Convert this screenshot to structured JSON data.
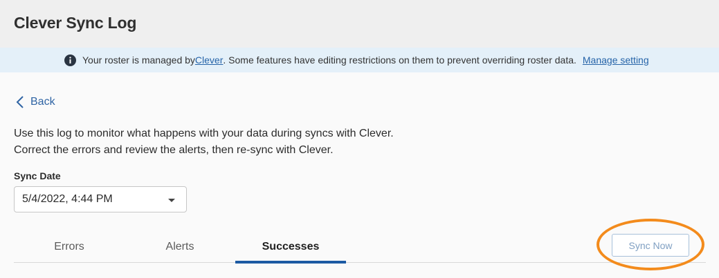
{
  "header": {
    "title": "Clever Sync Log"
  },
  "banner": {
    "icon": "info-icon",
    "text_before": "Your roster is managed by ",
    "clever_link": "Clever",
    "text_after": ". Some features have editing restrictions on them to prevent overriding roster data.",
    "manage_link": "Manage setting"
  },
  "nav": {
    "back_label": "Back",
    "back_icon": "chevron-left-icon"
  },
  "description": {
    "line1": "Use this log to monitor what happens with your data during syncs with Clever.",
    "line2": "Correct the errors and review the alerts, then re-sync with Clever."
  },
  "sync_date": {
    "label": "Sync Date",
    "selected": "5/4/2022, 4:44 PM"
  },
  "tabs": [
    {
      "label": "Errors",
      "active": false
    },
    {
      "label": "Alerts",
      "active": false
    },
    {
      "label": "Successes",
      "active": true
    }
  ],
  "actions": {
    "sync_now_label": "Sync Now"
  },
  "colors": {
    "accent": "#1c5aa3",
    "link": "#2563a8",
    "banner_bg": "#e4f0f9",
    "highlight": "#f38b1c"
  }
}
